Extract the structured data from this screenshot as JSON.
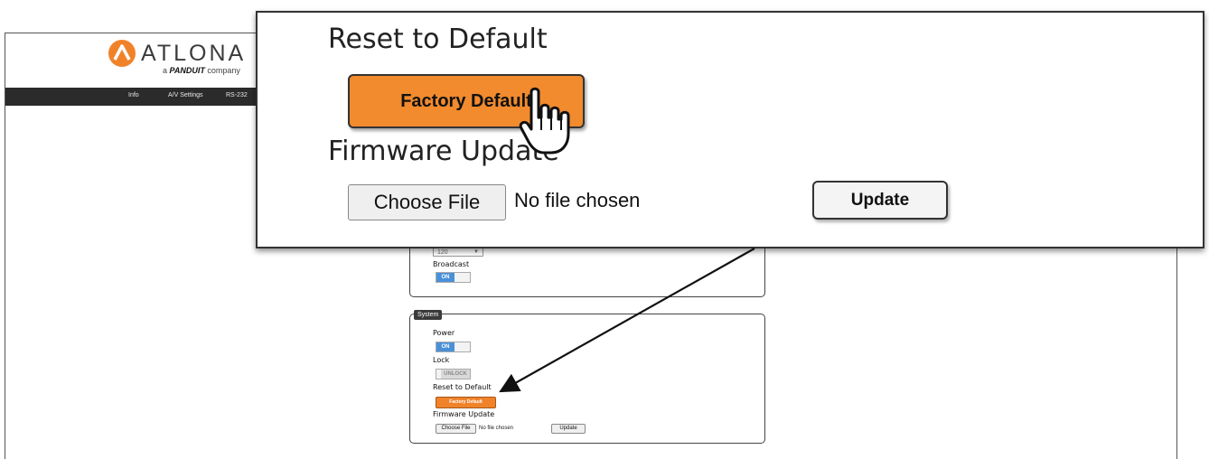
{
  "logo": {
    "brand": "ATLONA",
    "sub_prefix": "a ",
    "sub_brand": "PANDUIT",
    "sub_suffix": " company",
    "mark_color": "#f0832a"
  },
  "nav": {
    "items": [
      "Info",
      "A/V Settings",
      "RS-232"
    ]
  },
  "network_card": {
    "select_value": "120",
    "broadcast_label": "Broadcast",
    "broadcast_state": "ON"
  },
  "system_card": {
    "title": "System",
    "power_label": "Power",
    "power_state": "ON",
    "lock_label": "Lock",
    "lock_state": "UNLOCK",
    "reset_label": "Reset to Default",
    "factory_default_label": "Factory Default",
    "firmware_label": "Firmware Update",
    "choose_file_label": "Choose File",
    "no_file_text": "No file chosen",
    "update_label": "Update"
  },
  "callout": {
    "reset_heading": "Reset to Default",
    "factory_default_label": "Factory Default",
    "firmware_heading": "Firmware Update",
    "choose_file_label": "Choose File",
    "no_file_text": "No file chosen",
    "update_label": "Update"
  },
  "colors": {
    "accent_orange": "#f28a2e",
    "toggle_blue": "#4a90d9",
    "nav_bg": "#2b2b2b"
  },
  "icons": {
    "pointer": "hand-pointer-icon",
    "arrow": "callout-arrow-icon"
  }
}
